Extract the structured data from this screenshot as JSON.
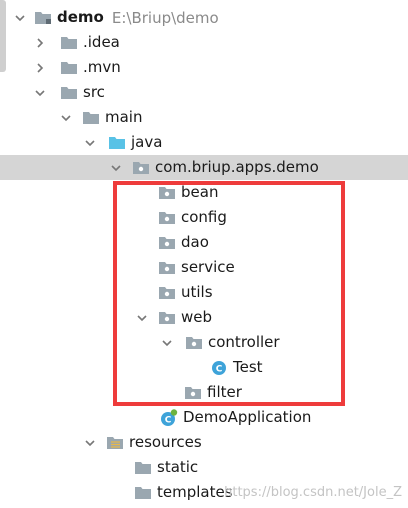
{
  "project": {
    "name": "demo",
    "path": "E:\\Briup\\demo"
  },
  "tree": {
    "idea": ".idea",
    "mvn": ".mvn",
    "src": "src",
    "main": "main",
    "java": "java",
    "package": "com.briup.apps.demo",
    "bean": "bean",
    "config": "config",
    "dao": "dao",
    "service": "service",
    "utils": "utils",
    "web": "web",
    "controller": "controller",
    "test": "Test",
    "filter": "filter",
    "app": "DemoApplication",
    "resources": "resources",
    "static": "static",
    "templates": "templates"
  },
  "watermark": "https://blog.csdn.net/Jole_Z",
  "colors": {
    "highlight": "#ee3b3b",
    "selection": "#d5d5d5",
    "folder": "#9aa7b0",
    "java_folder": "#59c2e6",
    "class_icon": "#3ea3d9"
  }
}
